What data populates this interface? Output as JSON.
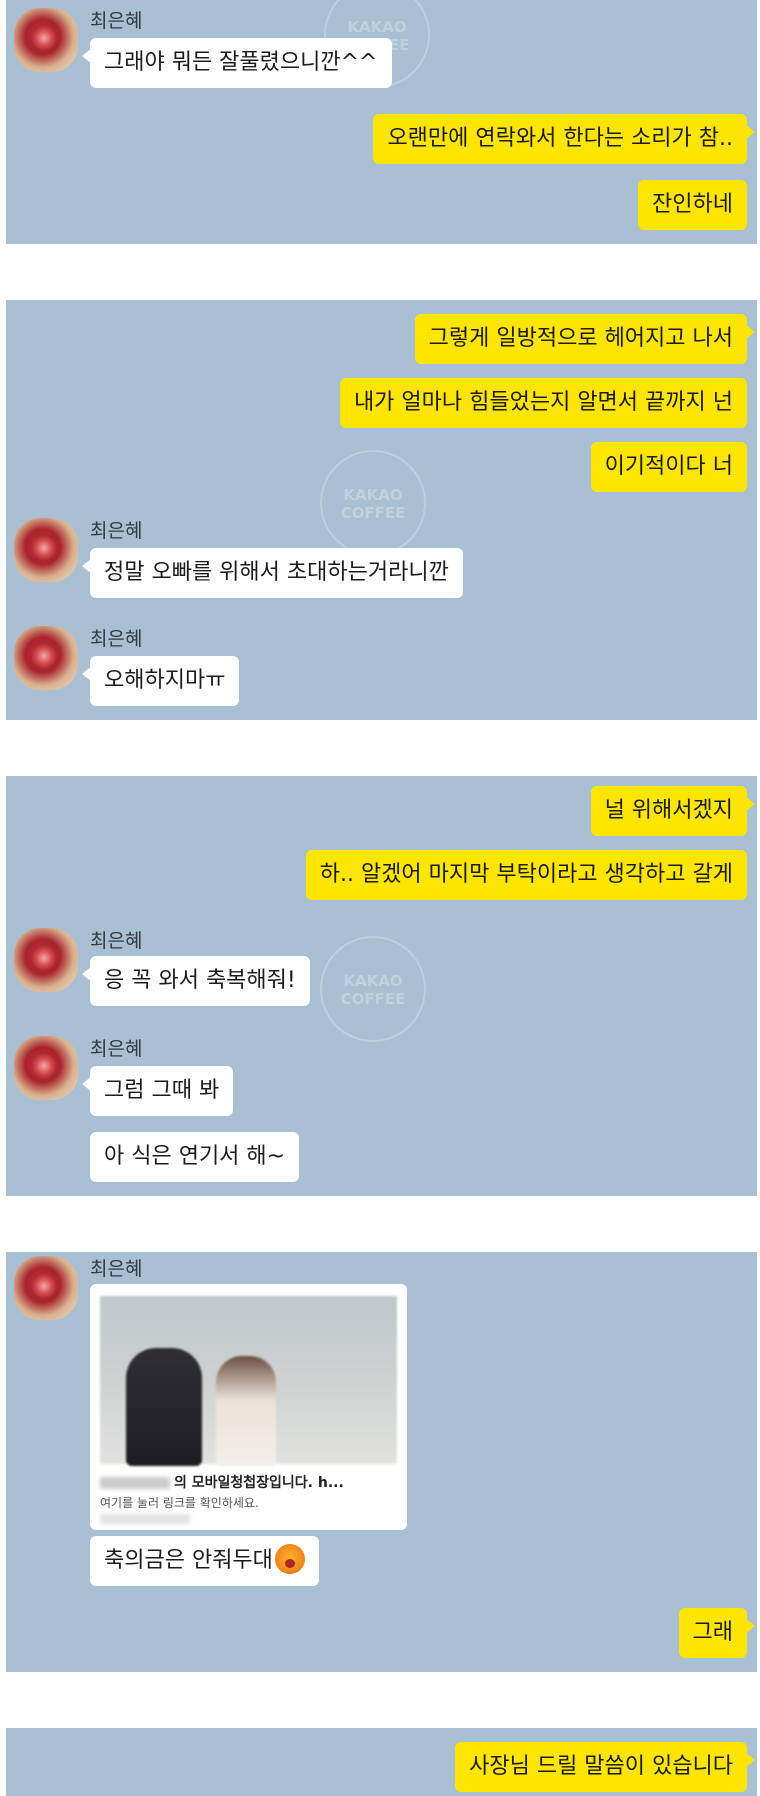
{
  "contact": {
    "name": "최은혜"
  },
  "watermark": {
    "line1": "KAKAO",
    "line2": "COFFEE"
  },
  "panels": [
    {
      "messages": [
        {
          "from": "them",
          "text": "그래야 뭐든 잘풀렸으니깐^^"
        },
        {
          "from": "me",
          "text": "오랜만에 연락와서 한다는 소리가 참.."
        },
        {
          "from": "me",
          "text": "잔인하네"
        }
      ]
    },
    {
      "messages": [
        {
          "from": "me",
          "text": "그렇게 일방적으로 헤어지고 나서"
        },
        {
          "from": "me",
          "text": "내가 얼마나 힘들었는지 알면서 끝까지 넌"
        },
        {
          "from": "me",
          "text": "이기적이다 너"
        },
        {
          "from": "them",
          "text": "정말 오빠를 위해서 초대하는거라니깐"
        },
        {
          "from": "them",
          "text": "오해하지마ㅠ"
        }
      ]
    },
    {
      "messages": [
        {
          "from": "me",
          "text": "널 위해서겠지"
        },
        {
          "from": "me",
          "text": "하.. 알겠어 마지막 부탁이라고 생각하고 갈게"
        },
        {
          "from": "them",
          "text": "응 꼭 와서 축복해줘!"
        },
        {
          "from": "them",
          "text": "그럼 그때 봐"
        },
        {
          "from": "them",
          "text": "아 식은 연기서 해~"
        }
      ]
    },
    {
      "link_card": {
        "title": "의 모바일청첩장입니다. h...",
        "subtitle": "여기를 눌러 링크를 확인하세요."
      },
      "messages": [
        {
          "from": "them",
          "text": "축의금은 안줘두대",
          "emoji": "scream-emoji"
        },
        {
          "from": "me",
          "text": "그래"
        }
      ]
    },
    {
      "messages": [
        {
          "from": "me",
          "text": "사장님 드릴 말씀이 있습니다"
        }
      ]
    }
  ]
}
